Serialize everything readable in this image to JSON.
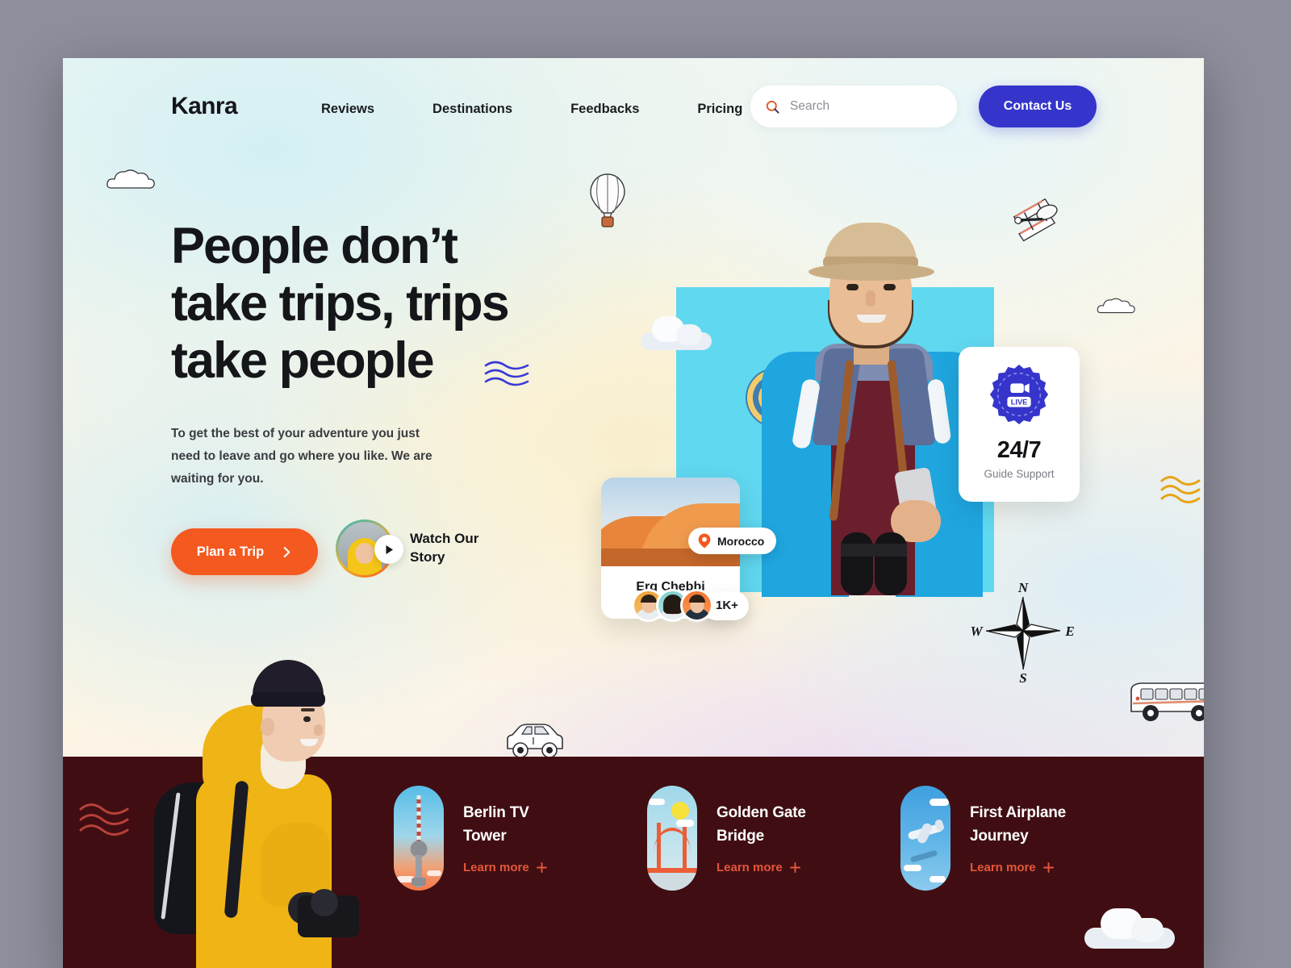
{
  "brand": {
    "logo": "Kanra"
  },
  "nav": {
    "links": [
      {
        "label": "Reviews",
        "name": "nav-link-reviews"
      },
      {
        "label": "Destinations",
        "name": "nav-link-destinations"
      },
      {
        "label": "Feedbacks",
        "name": "nav-link-feedbacks"
      },
      {
        "label": "Pricing",
        "name": "nav-link-pricing"
      }
    ],
    "search": {
      "placeholder": "Search",
      "value": "",
      "icon": "search-icon"
    },
    "contact_button": "Contact Us"
  },
  "hero": {
    "headline_line1": "People don’t",
    "headline_line2": "take trips, trips",
    "headline_line3": "take people",
    "subtitle": "To get the best of your adventure you just need to leave and go where you like. We are waiting for you.",
    "primary_button": "Plan a Trip",
    "primary_button_icon": "chevron-right-icon",
    "watch_story_line1": "Watch Our",
    "watch_story_line2": "Story",
    "watch_story_icon": "play-icon"
  },
  "support_card": {
    "badge_text": "LIVE",
    "badge_icon": "video-camera-icon",
    "value": "24/7",
    "label": "Guide Support"
  },
  "place_card": {
    "location": "Morocco",
    "location_icon": "map-pin-icon",
    "name": "Erg Chebbi",
    "member_count": "1K+"
  },
  "compass": {
    "north": "N",
    "west": "W",
    "east": "E",
    "south": "S"
  },
  "destinations": [
    {
      "title_line1": "Berlin TV",
      "title_line2": "Tower",
      "link": "Learn more",
      "link_icon": "plus-icon",
      "thumb": "berlin-tv-tower-thumb"
    },
    {
      "title_line1": "Golden Gate",
      "title_line2": "Bridge",
      "link": "Learn more",
      "link_icon": "plus-icon",
      "thumb": "golden-gate-bridge-thumb"
    },
    {
      "title_line1": "First Airplane",
      "title_line2": "Journey",
      "link": "Learn more",
      "link_icon": "plus-icon",
      "thumb": "airplane-journey-thumb"
    }
  ],
  "colors": {
    "accent_orange": "#f4591f",
    "accent_indigo": "#3535cc",
    "dark_band": "#400e12",
    "cyan_panel": "#60d8f0",
    "learn_more": "#e4563a"
  }
}
